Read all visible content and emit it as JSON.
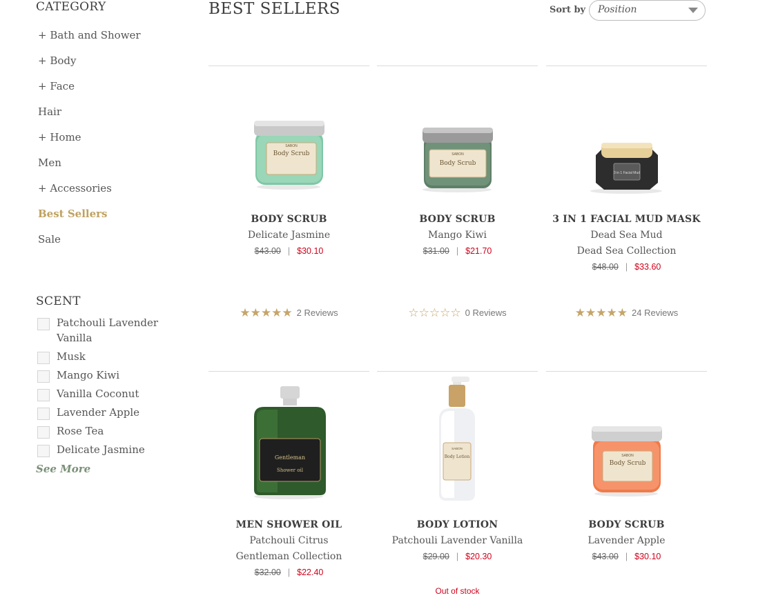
{
  "sidebar": {
    "category_heading": "CATEGORY",
    "categories": [
      "+ Bath and Shower",
      "+ Body",
      "+ Face",
      "Hair",
      "+ Home",
      "Men",
      "+ Accessories",
      "Best Sellers",
      "Sale"
    ],
    "active_category": "Best Sellers",
    "scent_heading": "SCENT",
    "scents": [
      "Patchouli Lavender Vanilla",
      "Musk",
      "Mango Kiwi",
      "Vanilla Coconut",
      "Lavender Apple",
      "Rose Tea",
      "Delicate Jasmine"
    ],
    "see_more": "See More"
  },
  "header": {
    "title": "BEST SELLERS",
    "sort_label": "Sort by",
    "sort_value": "Position"
  },
  "products": [
    {
      "name": "BODY SCRUB",
      "sub1": "Delicate Jasmine",
      "sub2": "",
      "old_price": "$43.00",
      "new_price": "$30.10",
      "rating": 5,
      "reviews": "2 Reviews",
      "stock": ""
    },
    {
      "name": "BODY SCRUB",
      "sub1": "Mango Kiwi",
      "sub2": "",
      "old_price": "$31.00",
      "new_price": "$21.70",
      "rating": 0,
      "reviews": "0 Reviews",
      "stock": ""
    },
    {
      "name": "3 IN 1 FACIAL MUD MASK",
      "sub1": "Dead Sea Mud",
      "sub2": "Dead Sea Collection",
      "old_price": "$48.00",
      "new_price": "$33.60",
      "rating": 5,
      "reviews": "24 Reviews",
      "stock": ""
    },
    {
      "name": "MEN SHOWER OIL",
      "sub1": "Patchouli Citrus",
      "sub2": "Gentleman Collection",
      "old_price": "$32.00",
      "new_price": "$22.40",
      "stock": ""
    },
    {
      "name": "BODY LOTION",
      "sub1": "Patchouli Lavender Vanilla",
      "sub2": "",
      "old_price": "$29.00",
      "new_price": "$20.30",
      "stock": "Out of stock"
    },
    {
      "name": "BODY SCRUB",
      "sub1": "Lavender Apple",
      "sub2": "",
      "old_price": "$43.00",
      "new_price": "$30.10",
      "stock": ""
    }
  ],
  "jar_labels": {
    "body_scrub": "Body Scrub",
    "mud_mask": "3 in 1 Facial Mud",
    "shower_oil": "Gentleman",
    "shower_oil_sub": "Shower oil",
    "lotion": "Body Lotion",
    "brand": "SABON"
  },
  "colors": {
    "accent_gold": "#bfa25f",
    "sale_red": "#d0021b",
    "see_more_green": "#7a9078",
    "star_gold": "#c5a56a"
  }
}
